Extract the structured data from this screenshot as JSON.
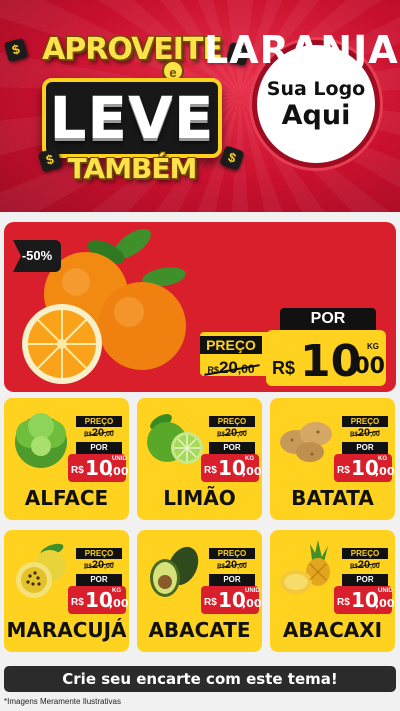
{
  "header": {
    "promo_line1": "APROVEITE",
    "promo_e": "e",
    "promo_line2": "LEVE",
    "promo_line3": "TAMBÉM",
    "coin_symbol": "$",
    "logo_line1": "Sua Logo",
    "logo_line2": "Aqui"
  },
  "colors": {
    "header_red": "#c8102e",
    "featured_red": "#d81f2b",
    "card_yellow": "#ffd21f",
    "dark": "#111111"
  },
  "featured": {
    "discount": "-50%",
    "name": "LARANJA",
    "image_icon": "orange-icon",
    "old_label": "PREÇO",
    "old_currency": "R$",
    "old_int": "20",
    "old_dec": ",00",
    "new_label": "POR",
    "new_currency": "R$",
    "new_int": "10",
    "new_dec": ",00",
    "unit": "KG"
  },
  "products": [
    {
      "name": "ALFACE",
      "icon": "lettuce-icon",
      "old_label": "PREÇO",
      "old_currency": "R$",
      "old_int": "20",
      "old_dec": ",00",
      "new_label": "POR",
      "new_currency": "R$",
      "new_int": "10",
      "new_dec": ",00",
      "unit": "UNID"
    },
    {
      "name": "LIMÃO",
      "icon": "lime-icon",
      "old_label": "PREÇO",
      "old_currency": "R$",
      "old_int": "20",
      "old_dec": ",00",
      "new_label": "POR",
      "new_currency": "R$",
      "new_int": "10",
      "new_dec": ",00",
      "unit": "KG"
    },
    {
      "name": "BATATA",
      "icon": "potato-icon",
      "old_label": "PREÇO",
      "old_currency": "R$",
      "old_int": "20",
      "old_dec": ",00",
      "new_label": "POR",
      "new_currency": "R$",
      "new_int": "10",
      "new_dec": ",00",
      "unit": "KG"
    },
    {
      "name": "MARACUJÁ",
      "icon": "passion-fruit-icon",
      "old_label": "PREÇO",
      "old_currency": "R$",
      "old_int": "20",
      "old_dec": ",00",
      "new_label": "POR",
      "new_currency": "R$",
      "new_int": "10",
      "new_dec": ",00",
      "unit": "KG"
    },
    {
      "name": "ABACATE",
      "icon": "avocado-icon",
      "old_label": "PREÇO",
      "old_currency": "R$",
      "old_int": "20",
      "old_dec": ",00",
      "new_label": "POR",
      "new_currency": "R$",
      "new_int": "10",
      "new_dec": ",00",
      "unit": "UNID"
    },
    {
      "name": "ABACAXI",
      "icon": "pineapple-icon",
      "old_label": "PREÇO",
      "old_currency": "R$",
      "old_int": "20",
      "old_dec": ",00",
      "new_label": "POR",
      "new_currency": "R$",
      "new_int": "10",
      "new_dec": ",00",
      "unit": "UNID"
    }
  ],
  "footer": {
    "cta": "Crie seu encarte com este tema!",
    "disclaimer": "*Imagens Meramente Ilustrativas"
  }
}
